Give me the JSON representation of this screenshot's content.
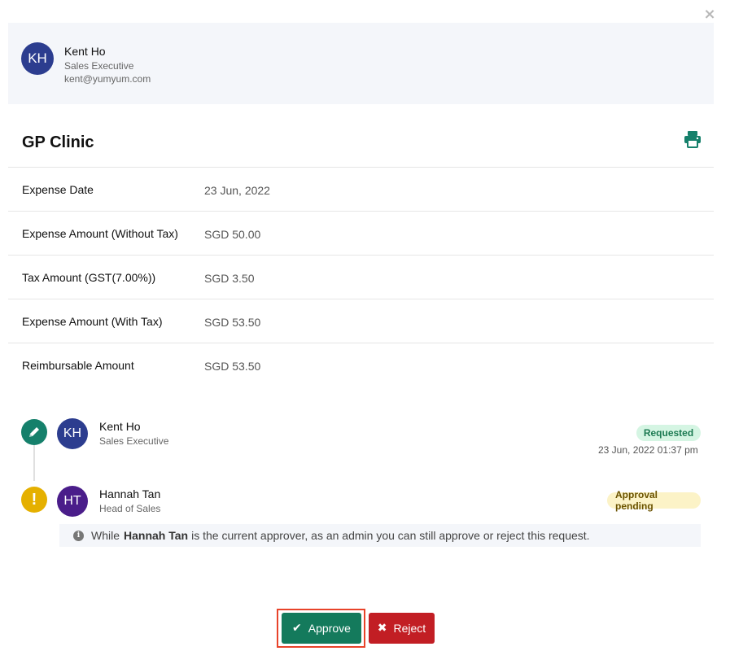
{
  "modal": {
    "close_glyph": "×"
  },
  "requester": {
    "initials": "KH",
    "name": "Kent Ho",
    "role": "Sales Executive",
    "email": "kent@yumyum.com",
    "avatar_color": "#2c3d8f"
  },
  "expense": {
    "title": "GP Clinic",
    "print_icon": "printer-icon",
    "details": [
      {
        "label": "Expense Date",
        "value": "23 Jun, 2022"
      },
      {
        "label": "Expense Amount (Without Tax)",
        "value": "SGD 50.00"
      },
      {
        "label": "Tax Amount (GST(7.00%))",
        "value": "SGD 3.50"
      },
      {
        "label": "Expense Amount (With Tax)",
        "value": "SGD 53.50"
      },
      {
        "label": "Reimbursable Amount",
        "value": "SGD 53.50"
      }
    ]
  },
  "timeline": [
    {
      "icon": "pencil-icon",
      "icon_color": "#15806b",
      "initials": "KH",
      "name": "Kent Ho",
      "role": "Sales Executive",
      "status": "Requested",
      "status_color": "#d5f5e3",
      "timestamp": "23 Jun, 2022 01:37 pm"
    },
    {
      "icon": "exclamation-icon",
      "icon_glyph": "!",
      "icon_color": "#e5b000",
      "initials": "HT",
      "name": "Hannah Tan",
      "role": "Head of Sales",
      "status": "Approval pending",
      "status_color": "#fcf3c7"
    }
  ],
  "admin_note": {
    "icon_glyph": "i",
    "prefix": "While",
    "approver": "Hannah Tan",
    "suffix": "is the current approver, as an admin you can still approve or reject this request."
  },
  "actions": {
    "approve_icon": "✔",
    "approve_label": "Approve",
    "reject_icon": "✖",
    "reject_label": "Reject",
    "approve_color": "#147a5c",
    "reject_color": "#c21e24",
    "highlight_color": "#e8432a"
  }
}
